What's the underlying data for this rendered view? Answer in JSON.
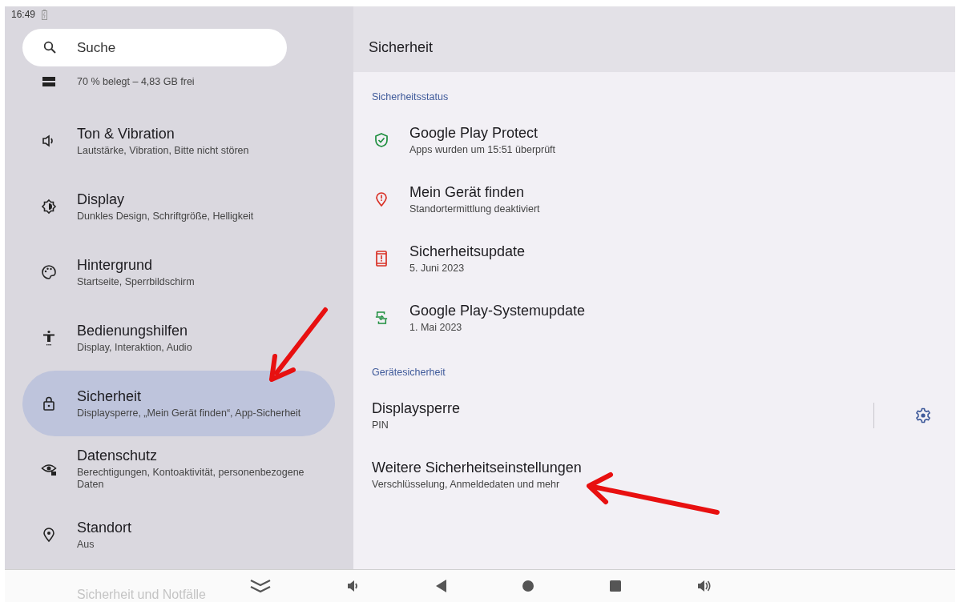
{
  "status_bar": {
    "time": "16:49"
  },
  "search": {
    "placeholder": "Suche"
  },
  "sidebar": {
    "items": [
      {
        "kind": "storage",
        "subtitle": "70 % belegt – 4,83 GB frei",
        "selected": false
      },
      {
        "kind": "sound",
        "title": "Ton & Vibration",
        "subtitle": "Lautstärke, Vibration, Bitte nicht stören",
        "selected": false
      },
      {
        "kind": "display",
        "title": "Display",
        "subtitle": "Dunkles Design, Schriftgröße, Helligkeit",
        "selected": false
      },
      {
        "kind": "palette",
        "title": "Hintergrund",
        "subtitle": "Startseite, Sperrbildschirm",
        "selected": false
      },
      {
        "kind": "accessibility",
        "title": "Bedienungshilfen",
        "subtitle": "Display, Interaktion, Audio",
        "selected": false
      },
      {
        "kind": "lock",
        "title": "Sicherheit",
        "subtitle": "Displaysperre, „Mein Gerät finden“, App-Sicherheit",
        "selected": true
      },
      {
        "kind": "privacy",
        "title": "Datenschutz",
        "subtitle": "Berechtigungen, Kontoaktivität, personenbezogene Daten",
        "selected": false
      },
      {
        "kind": "location",
        "title": "Standort",
        "subtitle": "Aus",
        "selected": false
      }
    ],
    "partial_item": "Sicherheit und Notfälle"
  },
  "page": {
    "title": "Sicherheit",
    "sections": [
      {
        "header": "Sicherheitsstatus",
        "items": [
          {
            "kind": "shield",
            "color": "#1e8e3e",
            "title": "Google Play Protect",
            "subtitle": "Apps wurden um 15:51 überprüft"
          },
          {
            "kind": "pin",
            "color": "#d93025",
            "title": "Mein Gerät finden",
            "subtitle": "Standortermittlung deaktiviert"
          },
          {
            "kind": "phone",
            "color": "#d93025",
            "title": "Sicherheitsupdate",
            "subtitle": "5. Juni 2023"
          },
          {
            "kind": "sync",
            "color": "#1e8e3e",
            "title": "Google Play-Systemupdate",
            "subtitle": "1. Mai 2023"
          }
        ]
      },
      {
        "header": "Gerätesicherheit",
        "items": [
          {
            "kind": "settings",
            "title": "Displaysperre",
            "subtitle": "PIN"
          },
          {
            "kind": "plain",
            "title": "Weitere Sicherheitseinstellungen",
            "subtitle": "Verschlüsselung, Anmeldedaten und mehr"
          }
        ]
      }
    ]
  }
}
